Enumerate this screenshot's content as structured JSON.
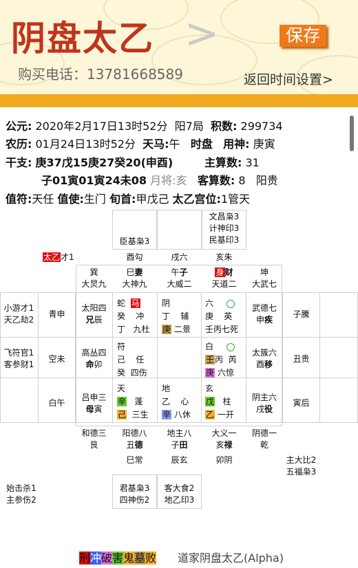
{
  "header": {
    "title": "阴盘太乙",
    "chevron": ">",
    "save_label": "保存",
    "phone": "购买电话：13781668589",
    "back": "返回时间设置>"
  },
  "info": {
    "row1": [
      "公元:",
      "2020年2月17日13时52分",
      "阳7局",
      "积数:",
      "299734"
    ],
    "row2": [
      "农历:",
      "01月24日13时52分",
      "天马:",
      "午",
      "时盘",
      "用神:",
      "庚寅"
    ],
    "row3": [
      "干支:",
      "庚37戊15庚27癸20(申酉)",
      "主算数:",
      "31"
    ],
    "row4": [
      "子01寅01寅24未08",
      "月将:",
      "亥",
      "客算数:",
      "8",
      "阳贵"
    ],
    "row5": [
      "值符:",
      "天任",
      "值使:",
      "生门",
      "旬首:",
      "甲戊己",
      "太乙宫位:",
      "1管天"
    ]
  },
  "grid": {
    "top_right": [
      "文昌枭3",
      "计神印3",
      "民基印3"
    ],
    "top_mid": "臣基枭3",
    "taiyi": "太乙",
    "taiyi_num": "才1",
    "top_row": [
      "酉勾",
      "戌六",
      "亥朱"
    ],
    "r1": [
      [
        "巽",
        "大炅九"
      ],
      [
        "巳",
        "妻",
        "大神九"
      ],
      [
        "午",
        "子",
        "大威二"
      ],
      [
        "身",
        "财",
        "天道二"
      ],
      [
        "坤",
        "大武七"
      ]
    ],
    "left_cols": [
      [
        "小游才1",
        "天乙劫2"
      ],
      [
        "飞符官1",
        "客参财1"
      ]
    ],
    "left_ring": [
      "青申",
      "空未",
      "白午"
    ],
    "left_inner": [
      [
        "太阳四",
        "兄",
        "辰"
      ],
      [
        "高丛四",
        "命",
        "卯"
      ],
      [
        "吕申三",
        "母",
        "寅"
      ]
    ],
    "right_inner": [
      [
        "武德七",
        "申",
        "疾"
      ],
      [
        "太簇六",
        "酉",
        "移"
      ],
      [
        "阴主六",
        "戌",
        "役"
      ]
    ],
    "right_ring": [
      "子騰",
      "丑贵",
      "寅后"
    ],
    "palaces": [
      {
        "l1": [
          "蛇",
          "马"
        ],
        "l2": [
          "癸",
          "冲"
        ],
        "l3": [
          "丁",
          "九杜"
        ]
      },
      {
        "l1": [
          "阴"
        ],
        "l2": [
          "丁",
          "辅"
        ],
        "l3": [
          "庚",
          "二景"
        ]
      },
      {
        "l1": [
          "六"
        ],
        "l2": [
          "庚",
          "英"
        ],
        "l3": [
          "壬丙七死"
        ]
      },
      {
        "l1": [
          "符"
        ],
        "l2": [
          "己",
          "任"
        ],
        "l3": [
          "癸",
          "四伤"
        ]
      },
      {
        "l1": [
          ""
        ],
        "l2": [
          ""
        ],
        "l3": [
          ""
        ]
      },
      {
        "l1": [
          "白"
        ],
        "l2": [
          "壬",
          "丙",
          "芮"
        ],
        "l3": [
          "庚",
          "六惊"
        ]
      },
      {
        "l1": [
          "天"
        ],
        "l2": [
          "辛",
          "蓬"
        ],
        "l3": [
          "己",
          "三生"
        ]
      },
      {
        "l1": [
          "地"
        ],
        "l2": [
          "乙",
          "心"
        ],
        "l3": [
          "辛",
          "八休"
        ]
      },
      {
        "l1": [
          "玄"
        ],
        "l2": [
          "戊",
          "柱"
        ],
        "l3": [
          "乙",
          "一开"
        ]
      }
    ],
    "bottom_row": [
      [
        "和德三",
        "艮"
      ],
      [
        "阳德八",
        "丑",
        "德"
      ],
      [
        "地主八",
        "子",
        "田"
      ],
      [
        "大义一",
        "亥",
        "禄"
      ],
      [
        "阴德一",
        "乾"
      ]
    ],
    "bottom_small": [
      "巳常",
      "辰玄",
      "卯阴"
    ],
    "bottom_right": [
      "主大比2",
      "五福枭3"
    ],
    "bottom_left": [
      "始击杀1",
      "主参伤2"
    ],
    "bottom_a": [
      "君基枭3",
      "四神伤2"
    ],
    "bottom_b": [
      "客大食2",
      "地乙印3"
    ]
  },
  "footer": {
    "legend": [
      "刑",
      "冲",
      "破",
      "害",
      "鬼",
      "墓",
      "败"
    ],
    "app": "道家阴盘太乙(Alpha)"
  },
  "colors": {
    "title": "#c0341d",
    "bar": "#f0a81e",
    "save": "#f07a1a"
  }
}
